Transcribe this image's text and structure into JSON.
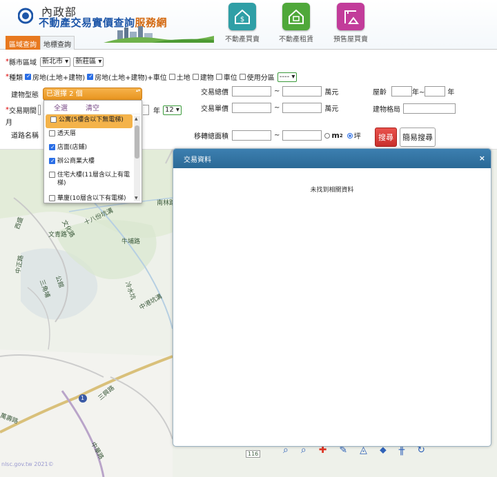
{
  "header": {
    "ministry": "內政部",
    "title_part1": "不動產交易實價查詢",
    "title_part2": "服務網",
    "nav": [
      {
        "label": "不動產買賣",
        "icon": "house-dollar-icon",
        "color": "#2f9fa6",
        "active": true
      },
      {
        "label": "不動產租賃",
        "icon": "house-rent-icon",
        "color": "#4fa83a",
        "active": false
      },
      {
        "label": "預售屋買賣",
        "icon": "crane-building-icon",
        "color": "#c23c9a",
        "active": false
      }
    ],
    "tabs": [
      "區域查詢",
      "地標查詢"
    ]
  },
  "form": {
    "county_label": "縣市區域",
    "county_value": "新北市",
    "district_value": "新莊區",
    "type_label": "種類",
    "types": [
      "房地(土地+建物)",
      "房地(土地+建物)+車位",
      "土地",
      "建物",
      "車位",
      "使用分區"
    ],
    "zone_value": "----",
    "building_type_label": "建物型態",
    "building_type_value": "已選擇 2 個",
    "period_label": "交易期間",
    "period_month_value": "12",
    "period_year_unit": "年",
    "period_month_unit": "月",
    "road_label": "道路名稱",
    "total_price_label": "交易總價",
    "unit_price_label": "交易單價",
    "area_label": "移轉總面積",
    "range_sep": "~",
    "price_unit": "萬元",
    "age_label": "屋齡",
    "age_unit_from": "年~",
    "age_unit_to": "年",
    "layout_label": "建物格局",
    "area_unit_m2": "m",
    "area_unit_sup": "2",
    "area_unit_ping": "坪",
    "search_button": "搜尋",
    "simple_search_button": "簡易搜尋"
  },
  "dropdown": {
    "select_all": "全選",
    "clear": "清空",
    "items": [
      {
        "label": "公寓(5樓含以下無電梯)",
        "checked": false,
        "highlighted": true
      },
      {
        "label": "透天厝",
        "checked": false,
        "highlighted": false
      },
      {
        "label": "店面(店鋪)",
        "checked": true,
        "highlighted": false
      },
      {
        "label": "辦公商業大樓",
        "checked": true,
        "highlighted": false
      },
      {
        "label": "住宅大樓(11層含以上有電梯)",
        "checked": false,
        "highlighted": false
      },
      {
        "label": "華廈(10層含以下有電梯)",
        "checked": false,
        "highlighted": false
      }
    ]
  },
  "panel": {
    "title": "交易資料",
    "close": "×",
    "message": "未找到相關資料"
  },
  "map": {
    "labels": [
      "南林路",
      "十八份坑溝",
      "文化路",
      "文青路",
      "中正路",
      "西盛",
      "公館",
      "三角埔",
      "冷水坑",
      "中港坑溝",
      "牛埔路",
      "三興路",
      "萬壽路",
      "中華路",
      "116"
    ],
    "route_shield": "1",
    "copyright": "nlsc.gov.tw 2021©"
  }
}
